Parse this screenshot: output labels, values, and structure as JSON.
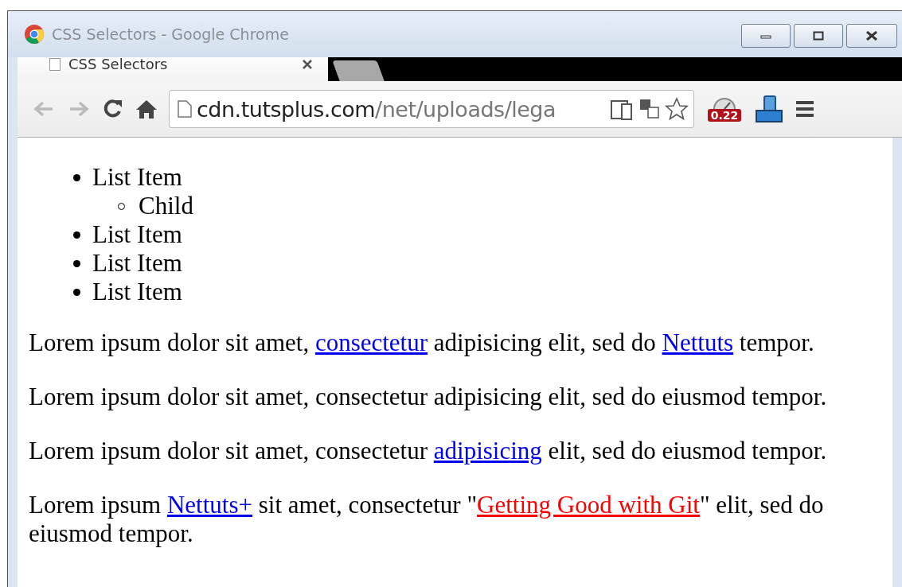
{
  "window": {
    "title": "CSS Selectors - Google Chrome"
  },
  "tabs": [
    {
      "label": "CSS Selectors",
      "selected": true
    }
  ],
  "address_bar": {
    "host": "cdn.tutsplus.com",
    "path": "/net/uploads/lega"
  },
  "extension_badge": "0.22",
  "list": [
    {
      "text": "List Item",
      "children": [
        {
          "text": "Child"
        }
      ]
    },
    {
      "text": "List Item"
    },
    {
      "text": "List Item"
    },
    {
      "text": "List Item"
    }
  ],
  "paragraphs": [
    [
      {
        "kind": "text",
        "text": "Lorem ipsum dolor sit amet, "
      },
      {
        "kind": "link",
        "text": "consectetur",
        "color": "#0000ee"
      },
      {
        "kind": "text",
        "text": " adipisicing elit, sed do "
      },
      {
        "kind": "link",
        "text": "Nettuts",
        "color": "#0000ee"
      },
      {
        "kind": "text",
        "text": " tempor."
      }
    ],
    [
      {
        "kind": "text",
        "text": "Lorem ipsum dolor sit amet, consectetur adipisicing elit, sed do eiusmod tempor."
      }
    ],
    [
      {
        "kind": "text",
        "text": "Lorem ipsum dolor sit amet, consectetur "
      },
      {
        "kind": "link",
        "text": "adipisicing",
        "color": "#0000ee"
      },
      {
        "kind": "text",
        "text": " elit, sed do eiusmod tempor."
      }
    ],
    [
      {
        "kind": "text",
        "text": "Lorem ipsum "
      },
      {
        "kind": "link",
        "text": "Nettuts+",
        "color": "#0000ee"
      },
      {
        "kind": "text",
        "text": " sit amet, consectetur \""
      },
      {
        "kind": "link",
        "text": "Getting Good with Git",
        "color": "#ff0000"
      },
      {
        "kind": "text",
        "text": "\" elit, sed do eiusmod tempor."
      }
    ]
  ]
}
